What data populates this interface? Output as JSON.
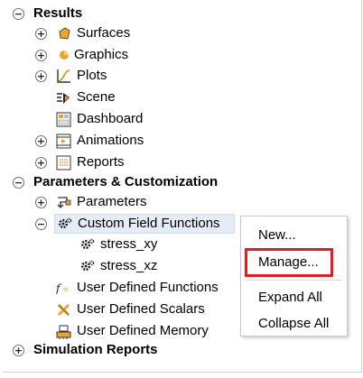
{
  "tree": {
    "results": {
      "label": "Results",
      "toggle": "−",
      "children": {
        "surfaces": {
          "label": "Surfaces",
          "toggle": "+",
          "icon": "surface-icon"
        },
        "graphics": {
          "label": "Graphics",
          "toggle": "+",
          "icon": "graphics-icon"
        },
        "plots": {
          "label": "Plots",
          "toggle": "+",
          "icon": "plot-icon"
        },
        "scene": {
          "label": "Scene",
          "icon": "scene-icon"
        },
        "dashboard": {
          "label": "Dashboard",
          "icon": "dashboard-icon"
        },
        "animations": {
          "label": "Animations",
          "toggle": "+",
          "icon": "animation-icon"
        },
        "reports": {
          "label": "Reports",
          "toggle": "+",
          "icon": "report-icon"
        }
      }
    },
    "params_custom": {
      "label": "Parameters & Customization",
      "toggle": "−",
      "children": {
        "parameters": {
          "label": "Parameters",
          "toggle": "+",
          "icon": "parameters-icon"
        },
        "custom_field_functions": {
          "label": "Custom Field Functions",
          "toggle": "−",
          "icon": "gear-icon",
          "selected": true,
          "children": [
            {
              "label": "stress_xy",
              "icon": "gear-icon"
            },
            {
              "label": "stress_xz",
              "icon": "gear-icon"
            }
          ]
        },
        "user_defined_functions": {
          "label": "User Defined Functions",
          "icon": "function-icon"
        },
        "user_defined_scalars": {
          "label": "User Defined Scalars",
          "icon": "scalar-icon"
        },
        "user_defined_memory": {
          "label": "User Defined Memory",
          "icon": "memory-icon"
        }
      }
    },
    "simulation_reports": {
      "label": "Simulation Reports",
      "toggle": "+"
    }
  },
  "context_menu": {
    "new": "New...",
    "manage": "Manage...",
    "expand_all": "Expand All",
    "collapse_all": "Collapse All"
  },
  "colors": {
    "selection": "#e5ecf6",
    "highlight_box": "#e31b23",
    "accent_orange": "#e8a33a"
  }
}
